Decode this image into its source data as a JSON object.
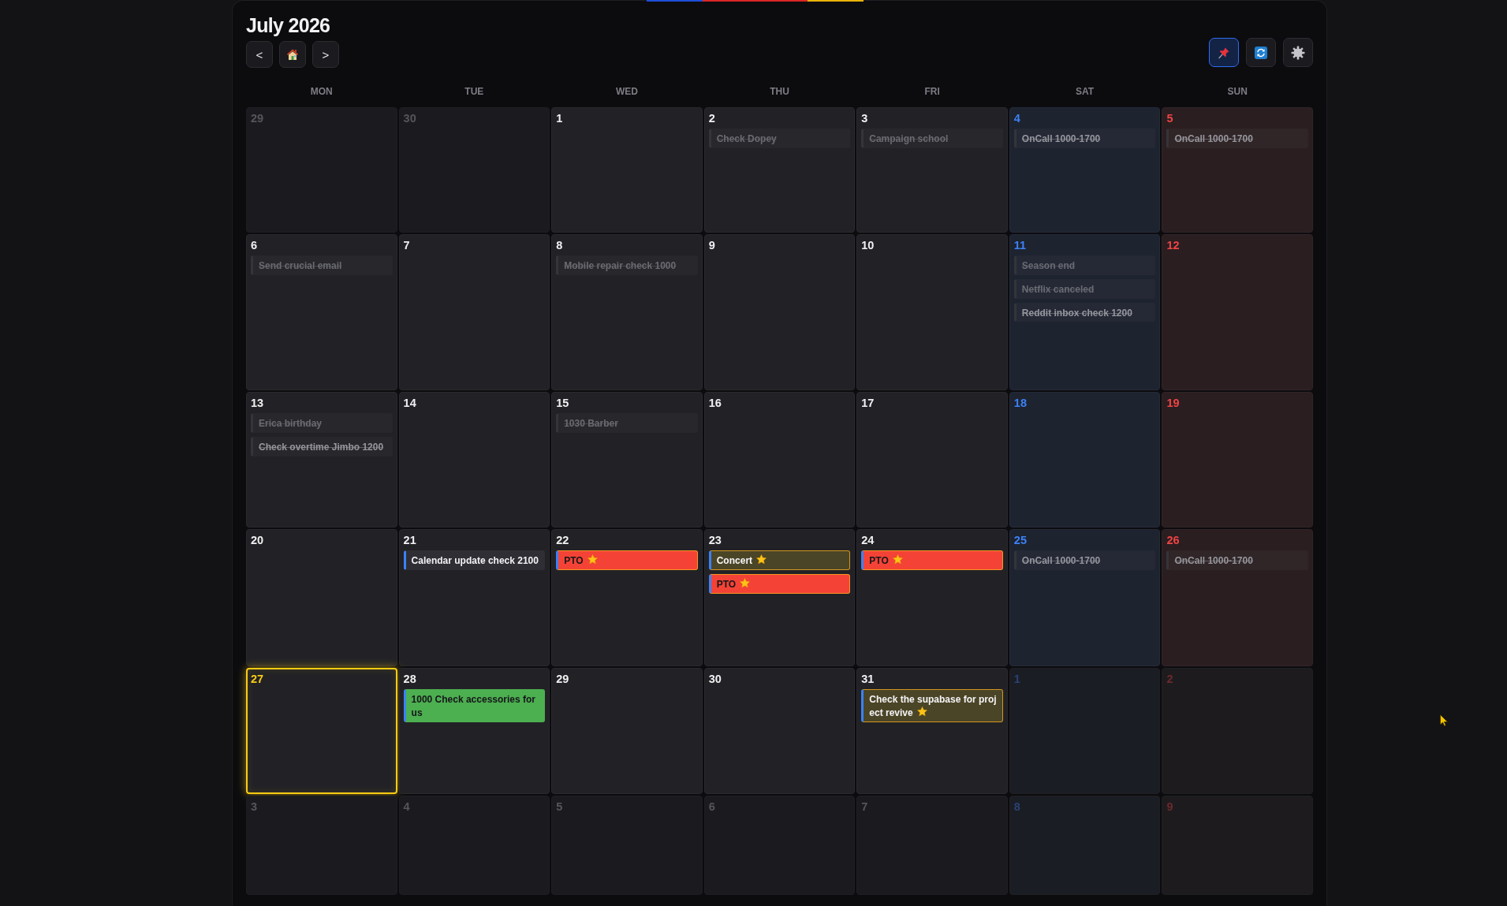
{
  "header": {
    "title": "July 2026",
    "nav": [
      {
        "kind": "prev",
        "label": "<"
      },
      {
        "kind": "today"
      },
      {
        "kind": "next",
        "label": ">"
      }
    ],
    "tools": [
      {
        "kind": "pin",
        "active": true
      },
      {
        "kind": "refresh",
        "active": false
      },
      {
        "kind": "settings",
        "active": false
      }
    ]
  },
  "weekdays": [
    {
      "label": "MON",
      "kind": "weekday"
    },
    {
      "label": "TUE",
      "kind": "weekday"
    },
    {
      "label": "WED",
      "kind": "weekday"
    },
    {
      "label": "THU",
      "kind": "weekday"
    },
    {
      "label": "FRI",
      "kind": "weekday"
    },
    {
      "label": "SAT",
      "kind": "saturday"
    },
    {
      "label": "SUN",
      "kind": "sunday"
    }
  ],
  "weeks": [
    {
      "days": [
        {
          "date": "29",
          "in_month": false,
          "today": false
        },
        {
          "date": "30",
          "in_month": false,
          "today": false
        },
        {
          "date": "1",
          "in_month": true,
          "today": false
        },
        {
          "date": "2",
          "in_month": true,
          "today": false,
          "events": [
            {
              "title": "Check Dopey",
              "kind": "colored",
              "done": true,
              "starred": false
            }
          ]
        },
        {
          "date": "3",
          "in_month": true,
          "today": false,
          "events": [
            {
              "title": "Campaign school",
              "kind": "colored",
              "done": true,
              "starred": false
            }
          ]
        },
        {
          "date": "4",
          "in_month": true,
          "today": false,
          "events": [
            {
              "title": "OnCall 1000-1700",
              "kind": "plain",
              "done": true,
              "starred": false
            }
          ]
        },
        {
          "date": "5",
          "in_month": true,
          "today": false,
          "events": [
            {
              "title": "OnCall 1000-1700",
              "kind": "plain",
              "done": true,
              "starred": false
            }
          ]
        }
      ]
    },
    {
      "days": [
        {
          "date": "6",
          "in_month": true,
          "today": false,
          "events": [
            {
              "title": "Send crucial email",
              "kind": "colored",
              "done": true,
              "starred": false
            }
          ]
        },
        {
          "date": "7",
          "in_month": true,
          "today": false
        },
        {
          "date": "8",
          "in_month": true,
          "today": false,
          "events": [
            {
              "title": "Mobile repair check 1000",
              "kind": "colored",
              "done": true,
              "starred": false
            }
          ]
        },
        {
          "date": "9",
          "in_month": true,
          "today": false
        },
        {
          "date": "10",
          "in_month": true,
          "today": false
        },
        {
          "date": "11",
          "in_month": true,
          "today": false,
          "events": [
            {
              "title": "Season end",
              "kind": "colored",
              "done": true,
              "starred": false
            },
            {
              "title": "Netflix canceled",
              "kind": "colored",
              "done": true,
              "starred": false
            },
            {
              "title": "Reddit inbox check 1200",
              "kind": "plain",
              "done": true,
              "starred": false
            }
          ]
        },
        {
          "date": "12",
          "in_month": true,
          "today": false
        }
      ]
    },
    {
      "days": [
        {
          "date": "13",
          "in_month": true,
          "today": false,
          "events": [
            {
              "title": "Erica birthday",
              "kind": "colored",
              "done": true,
              "starred": false
            },
            {
              "title": "Check overtime Jimbo 1200",
              "kind": "plain",
              "done": true,
              "starred": false
            }
          ]
        },
        {
          "date": "14",
          "in_month": true,
          "today": false
        },
        {
          "date": "15",
          "in_month": true,
          "today": false,
          "events": [
            {
              "title": "1030 Barber",
              "kind": "colored",
              "done": true,
              "starred": false
            }
          ]
        },
        {
          "date": "16",
          "in_month": true,
          "today": false
        },
        {
          "date": "17",
          "in_month": true,
          "today": false
        },
        {
          "date": "18",
          "in_month": true,
          "today": false
        },
        {
          "date": "19",
          "in_month": true,
          "today": false
        }
      ]
    },
    {
      "days": [
        {
          "date": "20",
          "in_month": true,
          "today": false
        },
        {
          "date": "21",
          "in_month": true,
          "today": false,
          "events": [
            {
              "title": "Calendar update check 2100",
              "kind": "plain",
              "done": false,
              "starred": false
            }
          ]
        },
        {
          "date": "22",
          "in_month": true,
          "today": false,
          "events": [
            {
              "title": "PTO",
              "kind": "colored",
              "color": "#f44336",
              "done": false,
              "starred": true
            }
          ]
        },
        {
          "date": "23",
          "in_month": true,
          "today": false,
          "events": [
            {
              "title": "Concert",
              "kind": "colored",
              "color": "#4b4527",
              "done": false,
              "starred": true
            },
            {
              "title": "PTO",
              "kind": "colored",
              "color": "#f44336",
              "done": false,
              "starred": true
            }
          ]
        },
        {
          "date": "24",
          "in_month": true,
          "today": false,
          "events": [
            {
              "title": "PTO",
              "kind": "colored",
              "color": "#f44336",
              "done": false,
              "starred": true
            }
          ]
        },
        {
          "date": "25",
          "in_month": true,
          "today": false,
          "events": [
            {
              "title": "OnCall 1000-1700",
              "kind": "plain",
              "done": true,
              "starred": false
            }
          ]
        },
        {
          "date": "26",
          "in_month": true,
          "today": false,
          "events": [
            {
              "title": "OnCall 1000-1700",
              "kind": "plain",
              "done": true,
              "starred": false
            }
          ]
        }
      ]
    },
    {
      "days": [
        {
          "date": "27",
          "in_month": true,
          "today": true
        },
        {
          "date": "28",
          "in_month": true,
          "today": false,
          "events": [
            {
              "title": "1000 Check accessories for us",
              "kind": "colored",
              "color": "#4caf50",
              "done": false,
              "starred": false
            }
          ]
        },
        {
          "date": "29",
          "in_month": true,
          "today": false
        },
        {
          "date": "30",
          "in_month": true,
          "today": false
        },
        {
          "date": "31",
          "in_month": true,
          "today": false,
          "events": [
            {
              "title": "Check the supabase for project revive",
              "kind": "colored",
              "color": "#4b4527",
              "done": false,
              "starred": true
            }
          ]
        },
        {
          "date": "1",
          "in_month": false,
          "today": false
        },
        {
          "date": "2",
          "in_month": false,
          "today": false
        }
      ]
    },
    {
      "days": [
        {
          "date": "3",
          "in_month": false,
          "today": false
        },
        {
          "date": "4",
          "in_month": false,
          "today": false
        },
        {
          "date": "5",
          "in_month": false,
          "today": false
        },
        {
          "date": "6",
          "in_month": false,
          "today": false
        },
        {
          "date": "7",
          "in_month": false,
          "today": false
        },
        {
          "date": "8",
          "in_month": false,
          "today": false
        },
        {
          "date": "9",
          "in_month": false,
          "today": false
        }
      ]
    }
  ]
}
